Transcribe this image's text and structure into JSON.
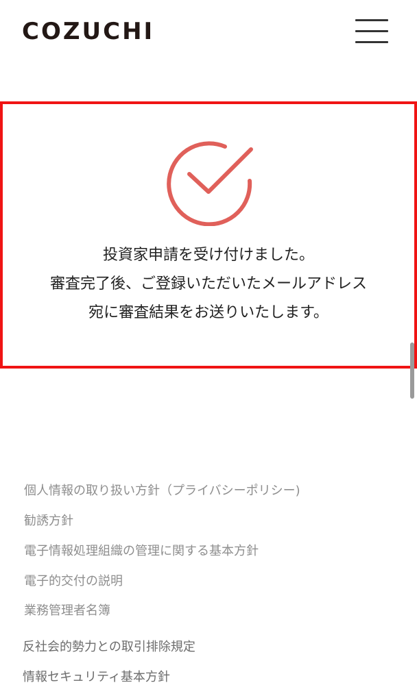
{
  "header": {
    "logo_text": "COZUCHI",
    "menu_icon": "hamburger-menu-icon"
  },
  "confirmation": {
    "icon": "check-circle-icon",
    "accent_color": "#e0605a",
    "highlight_color": "#f01414",
    "lines": [
      "投資家申請を受け付けました。",
      "審査完了後、ご登録いただいたメールアドレス",
      "宛に審査結果をお送りいたします。"
    ]
  },
  "footer": {
    "links": [
      "個人情報の取り扱い方針（プライバシーポリシー)",
      "勧誘方針",
      "電子情報処理組織の管理に関する基本方針",
      "電子的交付の説明",
      "業務管理者名簿",
      "反社会的勢力との取引排除規定",
      "情報セキュリティ基本方針"
    ]
  }
}
